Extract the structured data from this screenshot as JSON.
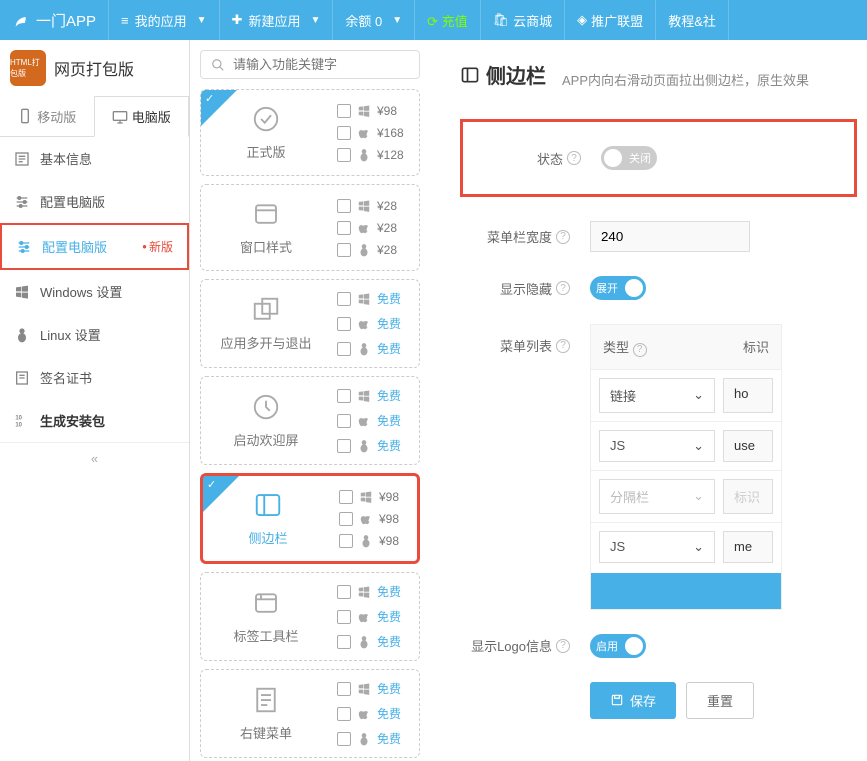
{
  "topbar": {
    "logo": "一门APP",
    "myapps": "我的应用",
    "newapp": "新建应用",
    "balance": "余额 0",
    "recharge": "充值",
    "mall": "云商城",
    "alliance": "推广联盟",
    "tutorial": "教程&社"
  },
  "app": {
    "icon_text": "HTML打包版",
    "title": "网页打包版"
  },
  "tabs": {
    "mobile": "移动版",
    "desktop": "电脑版"
  },
  "nav": {
    "basic": "基本信息",
    "config": "配置电脑版",
    "config_new": "配置电脑版",
    "new_badge": "新版",
    "windows": "Windows 设置",
    "linux": "Linux 设置",
    "cert": "签名证书",
    "build": "生成安装包"
  },
  "search": {
    "placeholder": "请输入功能关键字"
  },
  "features": [
    {
      "title": "正式版",
      "prices": [
        "¥98",
        "¥168",
        "¥128"
      ],
      "free": false,
      "selected": true,
      "active": false
    },
    {
      "title": "窗口样式",
      "prices": [
        "¥28",
        "¥28",
        "¥28"
      ],
      "free": false,
      "selected": false,
      "active": false
    },
    {
      "title": "应用多开与退出",
      "prices": [
        "免费",
        "免费",
        "免费"
      ],
      "free": true,
      "selected": false,
      "active": false
    },
    {
      "title": "启动欢迎屏",
      "prices": [
        "免费",
        "免费",
        "免费"
      ],
      "free": true,
      "selected": false,
      "active": false
    },
    {
      "title": "侧边栏",
      "prices": [
        "¥98",
        "¥98",
        "¥98"
      ],
      "free": false,
      "selected": true,
      "active": true
    },
    {
      "title": "标签工具栏",
      "prices": [
        "免费",
        "免费",
        "免费"
      ],
      "free": true,
      "selected": false,
      "active": false
    },
    {
      "title": "右键菜单",
      "prices": [
        "免费",
        "免费",
        "免费"
      ],
      "free": true,
      "selected": false,
      "active": false
    }
  ],
  "detail": {
    "title": "侧边栏",
    "desc": "APP内向右滑动页面拉出侧边栏，原生效果",
    "state_label": "状态",
    "state_text": "关闭",
    "width_label": "菜单栏宽度",
    "width_value": "240",
    "visibility_label": "显示隐藏",
    "visibility_text": "展开",
    "menulist_label": "菜单列表",
    "th_type": "类型",
    "th_id": "标识",
    "rows": [
      {
        "type": "链接",
        "id": "ho",
        "disabled": false
      },
      {
        "type": "JS",
        "id": "use",
        "disabled": false
      },
      {
        "type": "分隔栏",
        "id": "标识",
        "disabled": true
      },
      {
        "type": "JS",
        "id": "me",
        "disabled": false
      }
    ],
    "logo_label": "显示Logo信息",
    "logo_text": "启用",
    "save": "保存",
    "reset": "重置"
  }
}
